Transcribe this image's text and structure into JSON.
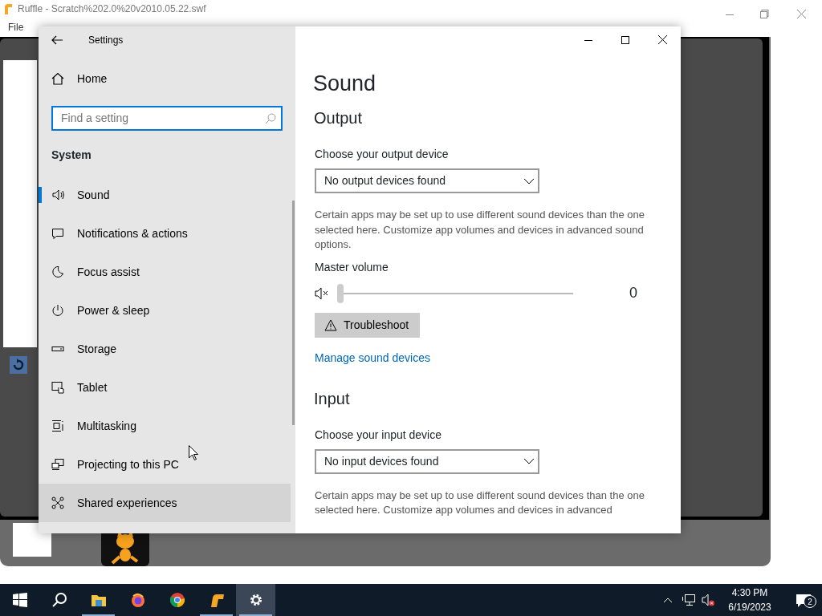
{
  "background_window": {
    "title": "Ruffle - Scratch%202.0%20v2010.05.22.swf",
    "menu": [
      "File"
    ]
  },
  "settings": {
    "title": "Settings",
    "home": "Home",
    "search": {
      "placeholder": "Find a setting"
    },
    "section": "System",
    "nav": [
      {
        "label": "Sound",
        "kind": "sound",
        "selected": true,
        "hovered": false
      },
      {
        "label": "Notifications & actions",
        "kind": "notifications",
        "selected": false,
        "hovered": false
      },
      {
        "label": "Focus assist",
        "kind": "moon",
        "selected": false,
        "hovered": false
      },
      {
        "label": "Power & sleep",
        "kind": "power",
        "selected": false,
        "hovered": false
      },
      {
        "label": "Storage",
        "kind": "storage",
        "selected": false,
        "hovered": false
      },
      {
        "label": "Tablet",
        "kind": "tablet",
        "selected": false,
        "hovered": false
      },
      {
        "label": "Multitasking",
        "kind": "multitasking",
        "selected": false,
        "hovered": false
      },
      {
        "label": "Projecting to this PC",
        "kind": "projecting",
        "selected": false,
        "hovered": false
      },
      {
        "label": "Shared experiences",
        "kind": "shared",
        "selected": false,
        "hovered": true
      }
    ]
  },
  "page": {
    "title": "Sound",
    "output": {
      "heading": "Output",
      "label": "Choose your output device",
      "device": "No output devices found",
      "description": "Certain apps may be set up to use different sound devices than the one selected here. Customize app volumes and devices in advanced sound options.",
      "volume_label": "Master volume",
      "volume": {
        "muted": true,
        "level": 0,
        "reading": "0"
      },
      "troubleshoot": "Troubleshoot",
      "link": "Manage sound devices"
    },
    "input": {
      "heading": "Input",
      "label": "Choose your input device",
      "device": "No input devices found",
      "description": "Certain apps may be set up to use different sound devices than the one selected here. Customize app volumes and devices in advanced"
    }
  },
  "taskbar": {
    "apps": [
      {
        "kind": "start",
        "running": false,
        "selected": false
      },
      {
        "kind": "search",
        "running": false,
        "selected": false
      },
      {
        "kind": "explorer",
        "running": true,
        "selected": false
      },
      {
        "kind": "firefox",
        "running": false,
        "selected": false
      },
      {
        "kind": "chrome",
        "running": false,
        "selected": false
      },
      {
        "kind": "ruffle",
        "running": true,
        "selected": false
      },
      {
        "kind": "settings",
        "running": true,
        "selected": true
      }
    ],
    "volume_muted": true,
    "time": "4:30 PM",
    "date": "6/19/2023",
    "notifications": "2"
  }
}
